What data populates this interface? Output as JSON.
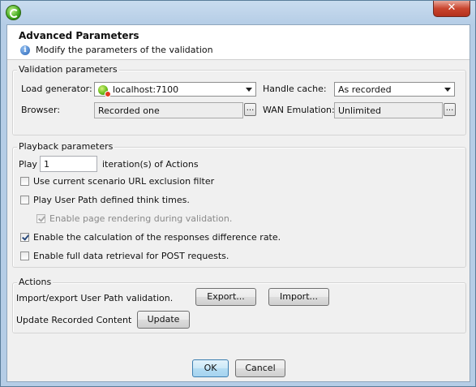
{
  "window": {
    "close_symbol": "✕"
  },
  "header": {
    "title": "Advanced Parameters",
    "subtitle": "Modify the parameters of the validation"
  },
  "validation": {
    "group_label": "Validation parameters",
    "load_generator_label": "Load generator:",
    "load_generator_value": "localhost:7100",
    "handle_cache_label": "Handle cache:",
    "handle_cache_value": "As recorded",
    "browser_label": "Browser:",
    "browser_value": "Recorded one",
    "wan_label": "WAN Emulation:",
    "wan_value": "Unlimited",
    "browse_label": "..."
  },
  "playback": {
    "group_label": "Playback parameters",
    "play_label": "Play",
    "play_value": "1",
    "iterations_label": "iteration(s) of Actions",
    "options": [
      {
        "label": "Use current scenario URL exclusion filter",
        "checked": false,
        "enabled": true
      },
      {
        "label": "Play User Path defined think times.",
        "checked": false,
        "enabled": true
      },
      {
        "label": "Enable page rendering during validation.",
        "checked": true,
        "enabled": false
      },
      {
        "label": "Enable the calculation of the responses difference rate.",
        "checked": true,
        "enabled": true
      },
      {
        "label": "Enable full data retrieval for POST requests.",
        "checked": false,
        "enabled": true
      }
    ]
  },
  "actions": {
    "group_label": "Actions",
    "import_export_label": "Import/export User Path validation.",
    "export_button": "Export...",
    "import_button": "Import...",
    "update_label": "Update Recorded Content",
    "update_button": "Update"
  },
  "footer": {
    "ok_button": "OK",
    "cancel_button": "Cancel"
  },
  "colors": {
    "title_bar": "#b5cde6",
    "dialog_bg": "#f0f0f0",
    "close_button": "#c9452e",
    "default_button": "#b4dcf3"
  }
}
